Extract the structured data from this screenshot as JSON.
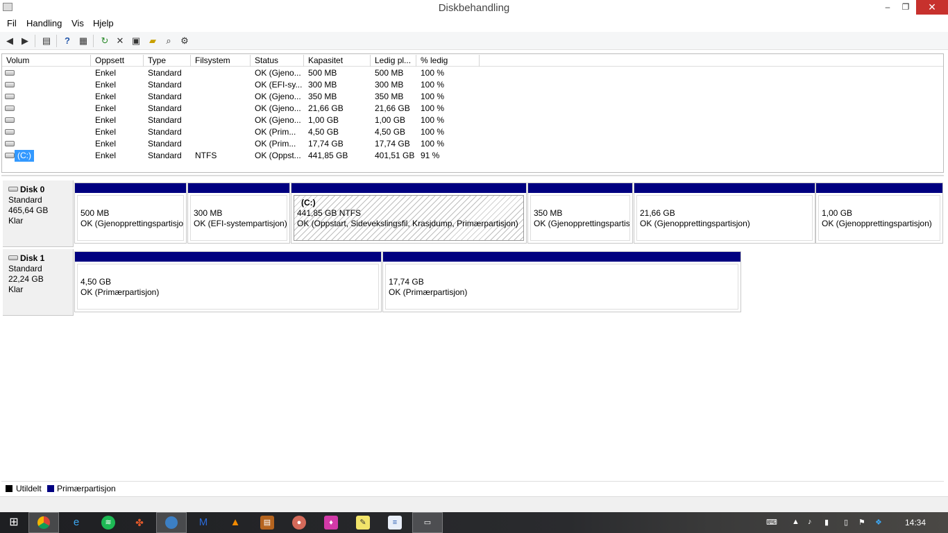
{
  "window": {
    "title": "Diskbehandling",
    "minimize": "–",
    "restore": "❐",
    "close": "✕"
  },
  "menu": [
    "Fil",
    "Handling",
    "Vis",
    "Hjelp"
  ],
  "toolbar": [
    "back-icon",
    "forward-icon",
    "console-tree-icon",
    "help-icon",
    "properties-icon",
    "refresh-icon",
    "delete-icon",
    "disk-properties-icon",
    "open-icon",
    "explore-icon",
    "settings-icon"
  ],
  "columns": [
    "Volum",
    "Oppsett",
    "Type",
    "Filsystem",
    "Status",
    "Kapasitet",
    "Ledig pl...",
    "% ledig"
  ],
  "volumes": [
    {
      "volum": "",
      "oppsett": "Enkel",
      "type": "Standard",
      "fs": "",
      "status": "OK (Gjeno...",
      "kap": "500 MB",
      "ledig": "500 MB",
      "pct": "100 %"
    },
    {
      "volum": "",
      "oppsett": "Enkel",
      "type": "Standard",
      "fs": "",
      "status": "OK (EFI-sy...",
      "kap": "300 MB",
      "ledig": "300 MB",
      "pct": "100 %"
    },
    {
      "volum": "",
      "oppsett": "Enkel",
      "type": "Standard",
      "fs": "",
      "status": "OK (Gjeno...",
      "kap": "350 MB",
      "ledig": "350 MB",
      "pct": "100 %"
    },
    {
      "volum": "",
      "oppsett": "Enkel",
      "type": "Standard",
      "fs": "",
      "status": "OK (Gjeno...",
      "kap": "21,66 GB",
      "ledig": "21,66 GB",
      "pct": "100 %"
    },
    {
      "volum": "",
      "oppsett": "Enkel",
      "type": "Standard",
      "fs": "",
      "status": "OK (Gjeno...",
      "kap": "1,00 GB",
      "ledig": "1,00 GB",
      "pct": "100 %"
    },
    {
      "volum": "",
      "oppsett": "Enkel",
      "type": "Standard",
      "fs": "",
      "status": "OK (Prim...",
      "kap": "4,50 GB",
      "ledig": "4,50 GB",
      "pct": "100 %"
    },
    {
      "volum": "",
      "oppsett": "Enkel",
      "type": "Standard",
      "fs": "",
      "status": "OK (Prim...",
      "kap": "17,74 GB",
      "ledig": "17,74 GB",
      "pct": "100 %"
    },
    {
      "volum": "(C:)",
      "oppsett": "Enkel",
      "type": "Standard",
      "fs": "NTFS",
      "status": "OK (Oppst...",
      "kap": "441,85 GB",
      "ledig": "401,51 GB",
      "pct": "91 %"
    }
  ],
  "disks": [
    {
      "name": "Disk 0",
      "type": "Standard",
      "size": "465,64 GB",
      "state": "Klar",
      "partitions": [
        {
          "label": "",
          "size": "500 MB",
          "status": "OK (Gjenopprettingspartisjo"
        },
        {
          "label": "",
          "size": "300 MB",
          "status": "OK (EFI-systempartisjon)"
        },
        {
          "label": "(C:)",
          "size": "441,85 GB NTFS",
          "status": "OK (Oppstart, Sidevekslingsfil, Krasjdump, Primærpartisjon)"
        },
        {
          "label": "",
          "size": "350 MB",
          "status": "OK (Gjenopprettingspartis"
        },
        {
          "label": "",
          "size": "21,66 GB",
          "status": "OK (Gjenopprettingspartisjon)"
        },
        {
          "label": "",
          "size": "1,00 GB",
          "status": "OK (Gjenopprettingspartisjon)"
        }
      ]
    },
    {
      "name": "Disk 1",
      "type": "Standard",
      "size": "22,24 GB",
      "state": "Klar",
      "partitions": [
        {
          "label": "",
          "size": "4,50 GB",
          "status": "OK (Primærpartisjon)"
        },
        {
          "label": "",
          "size": "17,74 GB",
          "status": "OK (Primærpartisjon)"
        }
      ]
    }
  ],
  "legend": [
    {
      "label": "Utildelt",
      "color": "#000000"
    },
    {
      "label": "Primærpartisjon",
      "color": "#000080"
    }
  ],
  "colors": {
    "primary_partition": "#000080",
    "selection": "#3399ff",
    "close_button": "#c7312d"
  },
  "taskbar": {
    "apps": [
      "windows-start-icon",
      "chrome-icon",
      "internet-explorer-icon",
      "spotify-icon",
      "app-icon",
      "thunderbird-icon",
      "malwarebytes-icon",
      "vlc-icon",
      "winrar-icon",
      "app-icon-2",
      "app-icon-3",
      "notepad-icon",
      "document-icon",
      "disk-management-icon"
    ],
    "clock": "14:34"
  }
}
